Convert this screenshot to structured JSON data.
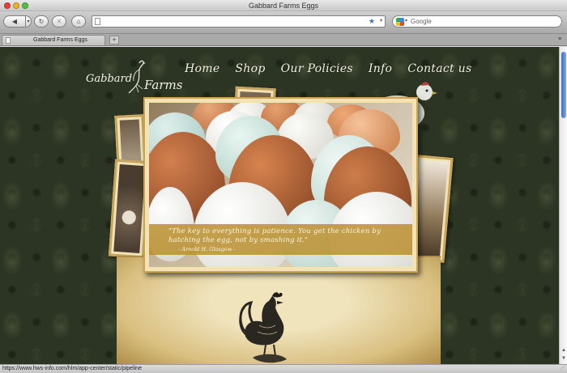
{
  "window": {
    "title": "Gabbard Farms Eggs"
  },
  "toolbar": {
    "url": "",
    "search_placeholder": "Google"
  },
  "tabs": [
    {
      "label": "Gabbard Farms Eggs"
    }
  ],
  "status": {
    "text": "https://www.hws-info.com/hlm/app-center/static/pipeline"
  },
  "site": {
    "logo": {
      "left": "Gabbard",
      "right": "Farms"
    },
    "nav": [
      {
        "label": "Home"
      },
      {
        "label": "Shop"
      },
      {
        "label": "Our Policies"
      },
      {
        "label": "Info"
      },
      {
        "label": "Contact us"
      }
    ],
    "slide": {
      "quote": "\"The key to everything is patience.  You get the chicken by hatching the egg, not by smashing it.\"",
      "author": "- Arnold H. Glasgow -"
    }
  },
  "colors": {
    "wallpaper": "#2c3523",
    "nav_text": "#f4f1e4",
    "caption_band": "#b88c28",
    "frame": "#c9a552"
  }
}
